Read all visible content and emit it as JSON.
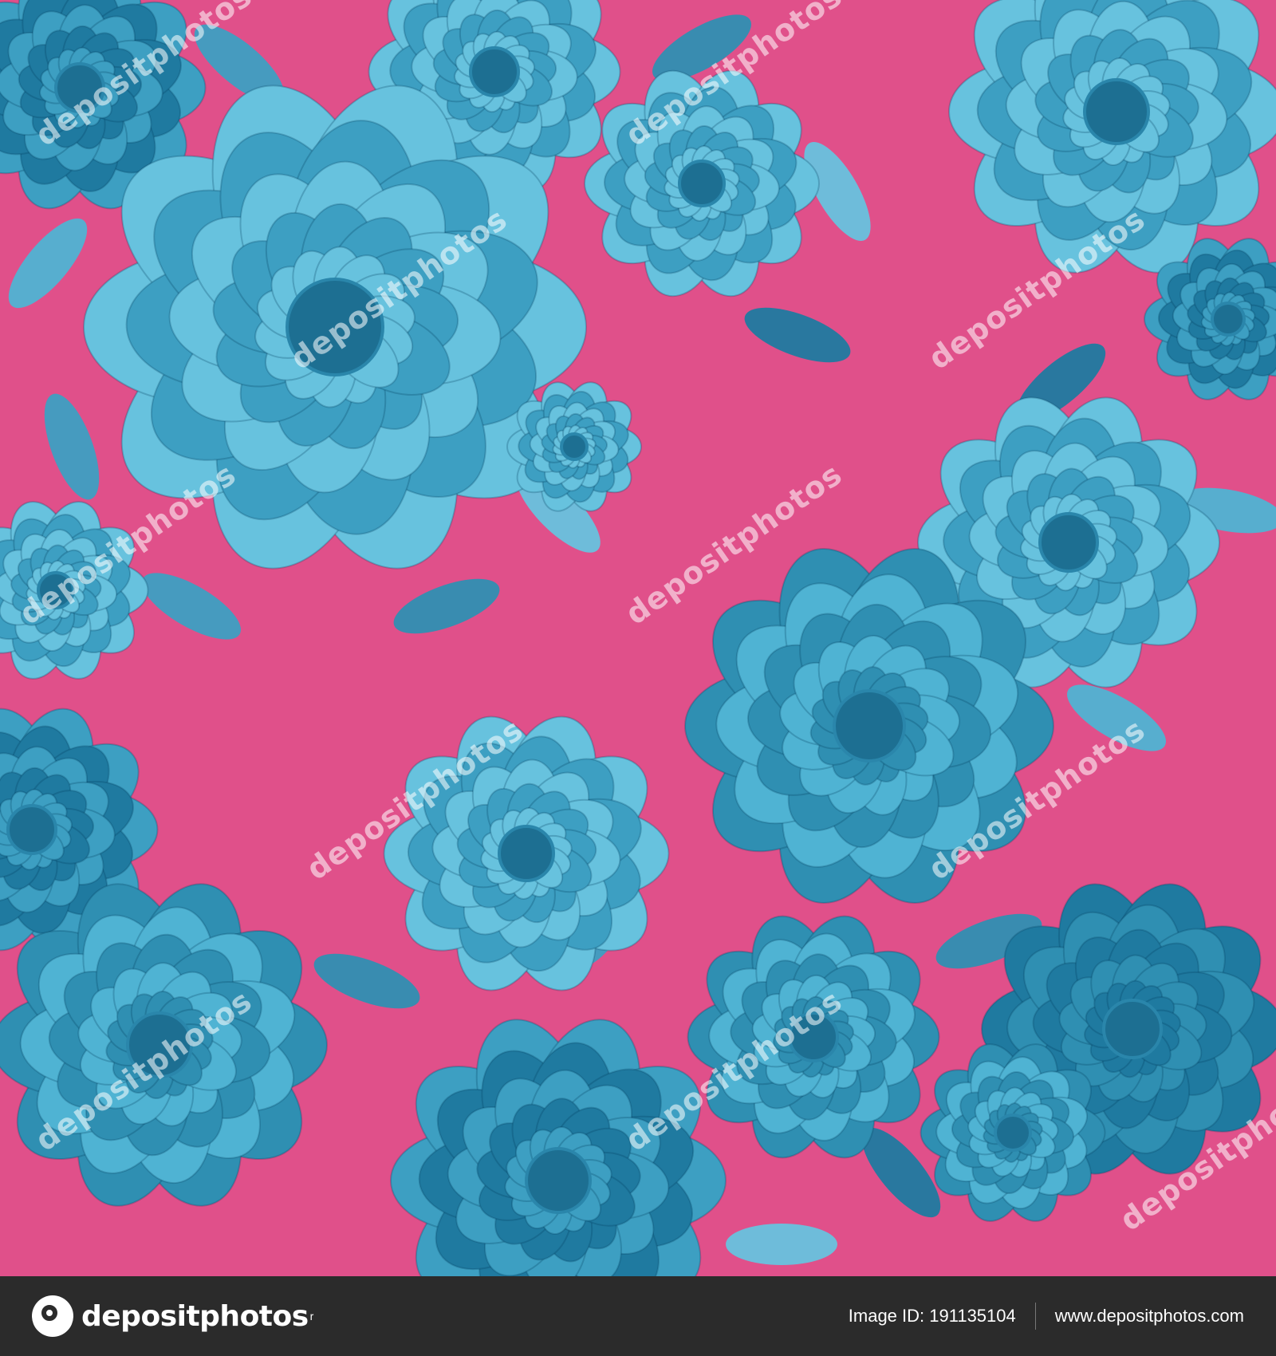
{
  "photo": {
    "background_color": "#e0508a",
    "flower_colors": [
      "#4fb3d3",
      "#3d9fc2",
      "#2f8fb2",
      "#67c2de",
      "#1f7aa0"
    ],
    "watermark_text": "depositphotos"
  },
  "footer": {
    "logo_text": "depositphotos",
    "logo_mark": "r",
    "image_id_label": "Image ID:",
    "image_id": "191135104",
    "site_url": "www.depositphotos.com"
  }
}
